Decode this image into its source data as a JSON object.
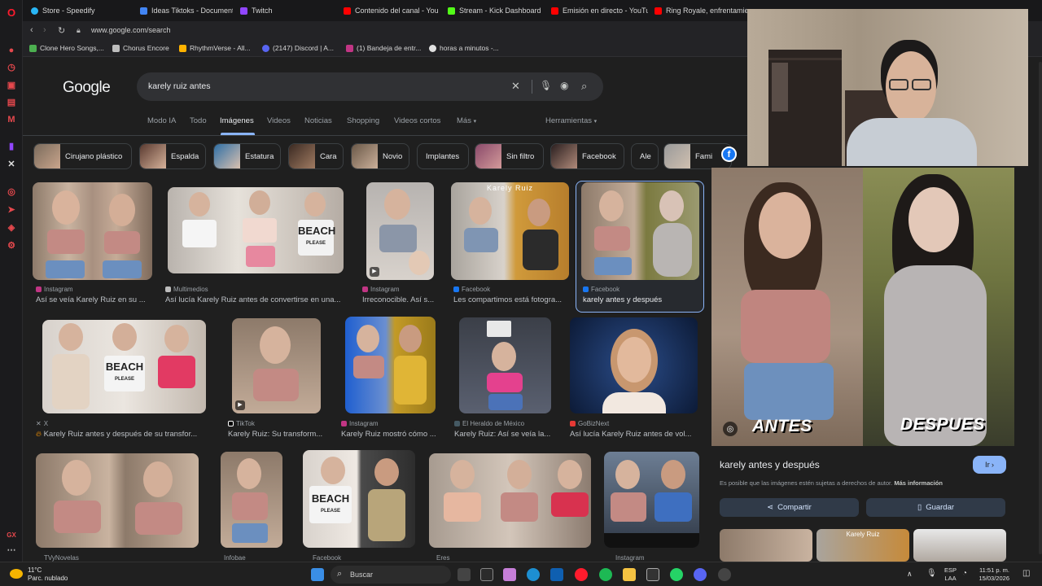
{
  "browser": {
    "tabs": [
      {
        "label": "Store - Speedify",
        "color": "#29b6f6"
      },
      {
        "label": "Ideas Tiktoks - Document",
        "color": "#4285f4"
      },
      {
        "label": "Twitch",
        "color": "#9146ff"
      },
      {
        "label": "Contenido del canal - You",
        "color": "#ff0000"
      },
      {
        "label": "Stream - Kick Dashboard",
        "color": "#53fc18"
      },
      {
        "label": "Emisión en directo - YouTu",
        "color": "#ff0000"
      },
      {
        "label": "Ring Royale, enfrentamiento",
        "color": "#ff0000"
      }
    ],
    "url": "www.google.com/search",
    "bookmarks": [
      {
        "label": "Clone Hero Songs,...",
        "color": "#4caf50"
      },
      {
        "label": "Chorus Encore",
        "color": "#bdbdbd"
      },
      {
        "label": "RhythmVerse - All...",
        "color": "#ffb300"
      },
      {
        "label": "(2147) Discord | A...",
        "color": "#5865f2"
      },
      {
        "label": "(1) Bandeja de entr...",
        "color": "#c13584"
      },
      {
        "label": "horas a minutos -...",
        "color": "#e0e0e0"
      }
    ]
  },
  "google": {
    "logo": "Google",
    "query": "karely ruiz antes",
    "nav_tabs": [
      "Modo IA",
      "Todo",
      "Imágenes",
      "Videos",
      "Noticias",
      "Shopping",
      "Videos cortos",
      "Más"
    ],
    "active_tab": "Imágenes",
    "tools": "Herramientas",
    "chips": [
      "Cirujano plástico",
      "Espalda",
      "Estatura",
      "Cara",
      "Novio",
      "Implantes",
      "Sin filtro",
      "Facebook",
      "Ale",
      "Fami"
    ],
    "row1": [
      {
        "source": "Instagram",
        "caption": "Así se veía Karely Ruiz en su ..."
      },
      {
        "source": "Multimedios",
        "caption": "Así lucía Karely Ruiz antes de convertirse en una..."
      },
      {
        "source": "Instagram",
        "caption": "Irreconocible. Así s..."
      },
      {
        "source": "Facebook",
        "caption": "Les compartimos está fotogra..."
      },
      {
        "source": "Facebook",
        "caption": "karely antes y después"
      }
    ],
    "row2": [
      {
        "source": "X",
        "caption": "Karely Ruiz antes y después de su transfor..."
      },
      {
        "source": "TikTok",
        "caption": "Karely Ruiz: Su transform..."
      },
      {
        "source": "Instagram",
        "caption": "Karely Ruiz mostró cómo ..."
      },
      {
        "source": "El Heraldo de México",
        "caption": "Karely Ruiz: Así se veía la..."
      },
      {
        "source": "GoBizNext",
        "caption": "Así lucía Karely Ruiz antes de vol..."
      }
    ],
    "row3_sources": [
      "TVyNovelas",
      "Infobae",
      "Facebook",
      "Eres",
      "Instagram"
    ],
    "overlay_texts": {
      "karely_ruiz": "Karely Ruiz",
      "beach": "BEACH",
      "please": "PLEASE"
    }
  },
  "panel": {
    "image_label_left": "ANTES",
    "image_label_right": "DESPUES",
    "title": "karely antes y después",
    "go_button": "Ir",
    "note": "Es posible que las imágenes estén sujetas a derechos de autor.",
    "note_link": "Más información",
    "share": "Compartir",
    "save": "Guardar",
    "related_overlay": "Karely Ruiz"
  },
  "taskbar": {
    "temp": "11°C",
    "weather": "Parc. nublado",
    "search": "Buscar",
    "lang1": "ESP",
    "lang2": "LAA",
    "time": "11:51 p. m.",
    "date": "15/03/2026"
  }
}
